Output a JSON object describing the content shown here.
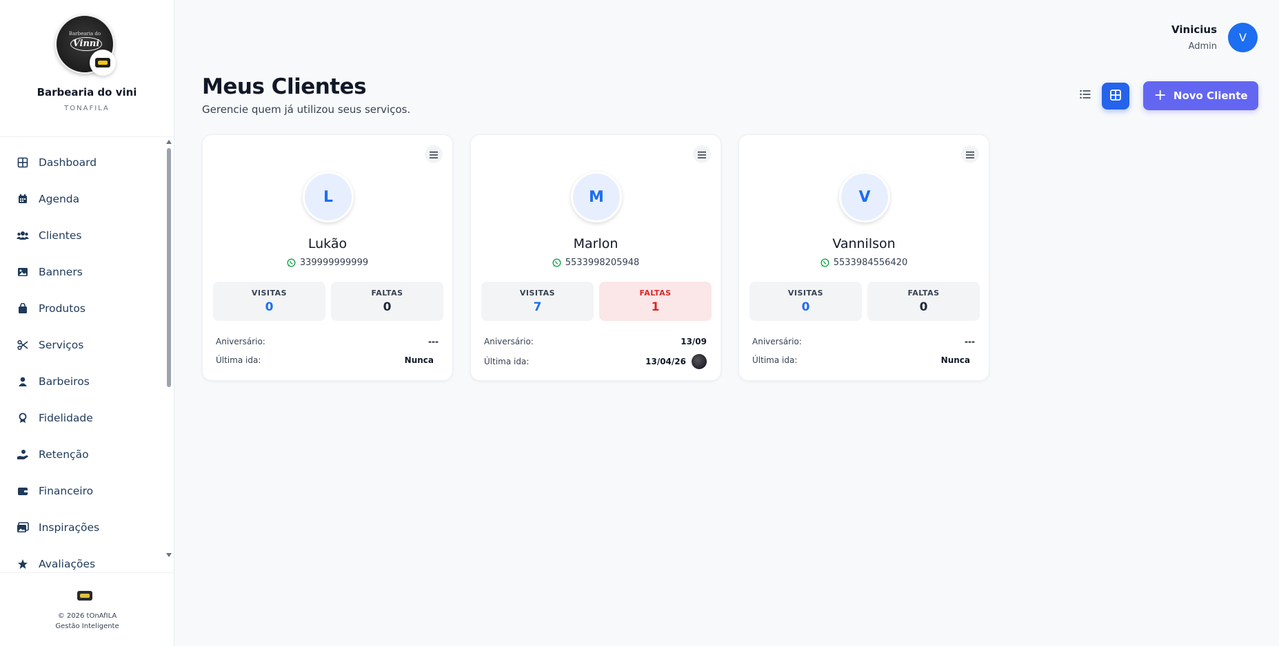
{
  "sidebar": {
    "brand_name": "Barbearia do vini",
    "brand_sub": "TONAFILA",
    "logo_text": "Vinni",
    "logo_script": "Barbearia do",
    "items": [
      {
        "label": "Dashboard",
        "icon": "dashboard-icon"
      },
      {
        "label": "Agenda",
        "icon": "calendar-icon"
      },
      {
        "label": "Clientes",
        "icon": "users-icon"
      },
      {
        "label": "Banners",
        "icon": "image-icon"
      },
      {
        "label": "Produtos",
        "icon": "bag-icon"
      },
      {
        "label": "Serviços",
        "icon": "scissors-icon"
      },
      {
        "label": "Barbeiros",
        "icon": "user-icon"
      },
      {
        "label": "Fidelidade",
        "icon": "award-icon"
      },
      {
        "label": "Retenção",
        "icon": "hand-icon"
      },
      {
        "label": "Financeiro",
        "icon": "wallet-icon"
      },
      {
        "label": "Inspirações",
        "icon": "images-icon"
      },
      {
        "label": "Avaliações",
        "icon": "star-icon"
      }
    ],
    "footer_copy": "© 2026 tOnAfILA",
    "footer_tagline": "Gestão Inteligente"
  },
  "header": {
    "user_name": "Vinicius",
    "user_role": "Admin",
    "user_initial": "V"
  },
  "main": {
    "title": "Meus Clientes",
    "subtitle": "Gerencie quem já utilizou seus serviços.",
    "new_button": "Novo Cliente",
    "view_mode": "grid"
  },
  "labels": {
    "visits": "VISITAS",
    "absences": "FALTAS",
    "birthday": "Aniversário:",
    "last_visit": "Última ida:"
  },
  "clients": [
    {
      "initial": "L",
      "name": "Lukão",
      "phone": "339999999999",
      "visits": "0",
      "absences": "0",
      "birthday": "---",
      "last_visit": "Nunca"
    },
    {
      "initial": "M",
      "name": "Marlon",
      "phone": "5533998205948",
      "visits": "7",
      "absences": "1",
      "birthday": "13/09",
      "last_visit": "13/04/26"
    },
    {
      "initial": "V",
      "name": "Vannilson",
      "phone": "5533984556420",
      "visits": "0",
      "absences": "0",
      "birthday": "---",
      "last_visit": "Nunca"
    }
  ],
  "colors": {
    "primary": "#2563eb",
    "accent": "#6366f1",
    "danger": "#dc2626",
    "whatsapp": "#16a34a"
  }
}
